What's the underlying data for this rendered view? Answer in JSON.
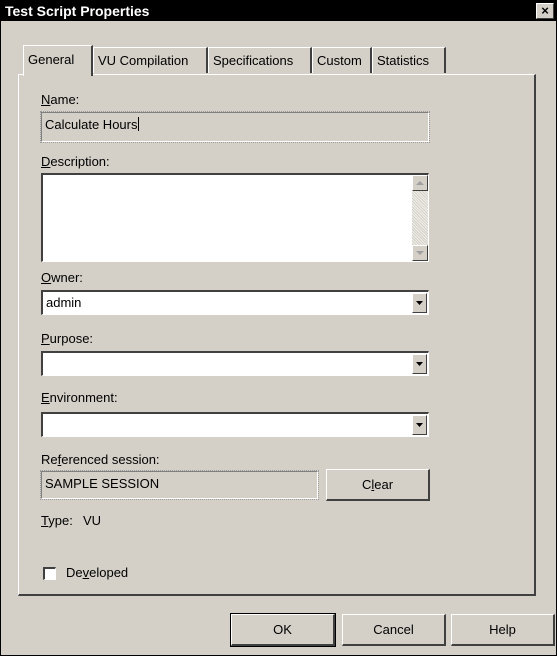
{
  "window": {
    "title": "Test Script Properties",
    "close_glyph": "×"
  },
  "tabs": [
    {
      "label": "General",
      "active": true
    },
    {
      "label": "VU Compilation",
      "active": false
    },
    {
      "label": "Specifications",
      "active": false
    },
    {
      "label": "Custom",
      "active": false
    },
    {
      "label": "Statistics",
      "active": false
    }
  ],
  "general": {
    "name": {
      "label_key": "N",
      "label_rest": "ame:",
      "value": "Calculate Hours"
    },
    "description": {
      "label_key": "D",
      "label_rest": "escription:",
      "value": ""
    },
    "owner": {
      "label_key": "O",
      "label_rest": "wner:",
      "value": "admin"
    },
    "purpose": {
      "label_key": "P",
      "label_rest": "urpose:",
      "value": ""
    },
    "environment": {
      "label_key": "E",
      "label_rest": "nvironment:",
      "value": ""
    },
    "referenced_session": {
      "label_pre": "Re",
      "label_key": "f",
      "label_rest": "erenced session:",
      "value": "SAMPLE SESSION",
      "clear_pre": "C",
      "clear_key": "l",
      "clear_rest": "ear"
    },
    "type": {
      "label_key": "T",
      "label_rest": "ype:",
      "value": "VU"
    },
    "developed": {
      "label_pre": "De",
      "label_key": "v",
      "label_rest": "eloped",
      "checked": false
    }
  },
  "footer": {
    "ok_label": "OK",
    "cancel_label": "Cancel",
    "help_label": "Help"
  }
}
